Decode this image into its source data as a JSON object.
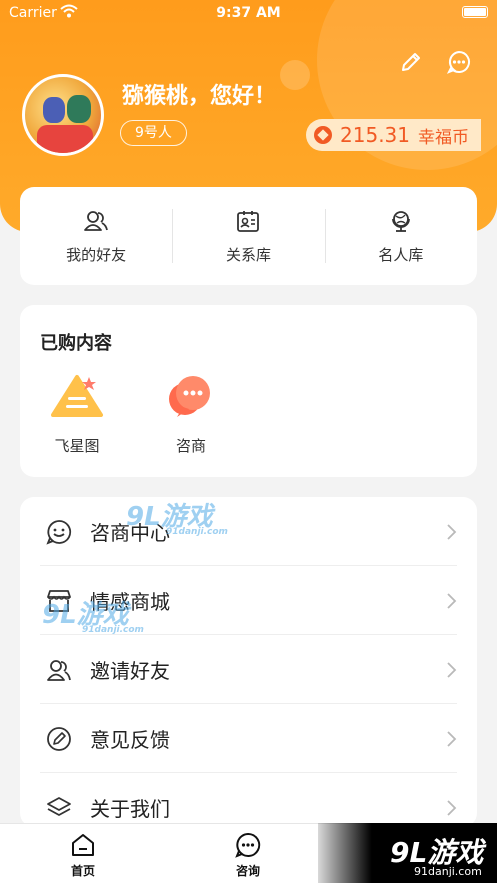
{
  "status_bar": {
    "carrier": "Carrier",
    "time": "9:37 AM"
  },
  "profile": {
    "greeting": "猕猴桃，您好！",
    "level": "9号人",
    "coin_amount": "215.31",
    "coin_unit": "幸福币"
  },
  "colors": {
    "primary": "#ff9c1c",
    "coin": "#f15a24",
    "background": "#f3f3f3"
  },
  "quick_links": [
    {
      "label": "我的好友",
      "icon": "friends-icon"
    },
    {
      "label": "关系库",
      "icon": "contact-card-icon"
    },
    {
      "label": "名人库",
      "icon": "globe-icon"
    }
  ],
  "purchased": {
    "title": "已购内容",
    "items": [
      {
        "label": "飞星图",
        "icon": "flying-star-icon"
      },
      {
        "label": "咨商",
        "icon": "chat-bubbles-icon"
      }
    ]
  },
  "menu": [
    {
      "label": "咨商中心",
      "icon": "smile-chat-icon"
    },
    {
      "label": "情感商城",
      "icon": "store-icon"
    },
    {
      "label": "邀请好友",
      "icon": "invite-friends-icon"
    },
    {
      "label": "意见反馈",
      "icon": "feedback-icon"
    },
    {
      "label": "关于我们",
      "icon": "layers-icon"
    }
  ],
  "watermarks": [
    {
      "main": "9L游戏",
      "sub": "91danji.com"
    },
    {
      "main": "9L游戏",
      "sub": "91danji.com"
    }
  ],
  "tabbar": [
    {
      "label": "首页",
      "icon": "home-icon"
    },
    {
      "label": "咨询",
      "icon": "consult-icon"
    }
  ],
  "brand": {
    "main": "9L游戏",
    "sub": "91danji.com"
  }
}
